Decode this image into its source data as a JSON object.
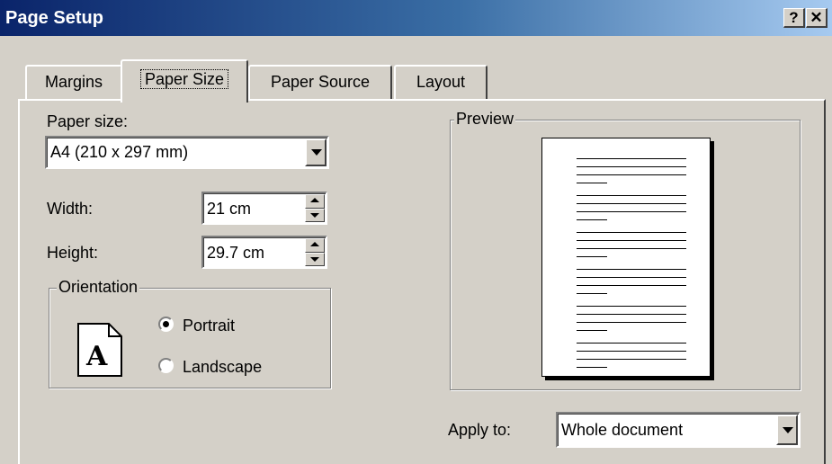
{
  "window": {
    "title": "Page Setup",
    "help_glyph": "?",
    "close_glyph": "✕"
  },
  "tabs": [
    {
      "label": "Margins",
      "active": false
    },
    {
      "label": "Paper Size",
      "active": true
    },
    {
      "label": "Paper Source",
      "active": false
    },
    {
      "label": "Layout",
      "active": false
    }
  ],
  "paper_size": {
    "label": "Paper size:",
    "value": "A4 (210 x 297 mm)"
  },
  "width": {
    "label": "Width:",
    "value": "21 cm"
  },
  "height": {
    "label": "Height:",
    "value": "29.7 cm"
  },
  "orientation": {
    "label": "Orientation",
    "icon_letter": "A",
    "portrait_label": "Portrait",
    "landscape_label": "Landscape",
    "selected": "Portrait"
  },
  "preview": {
    "label": "Preview"
  },
  "apply_to": {
    "label": "Apply to:",
    "value": "Whole document"
  },
  "colors": {
    "title_bar_start": "#0a246a",
    "title_bar_end": "#a6caf0",
    "face": "#d4d0c8"
  }
}
